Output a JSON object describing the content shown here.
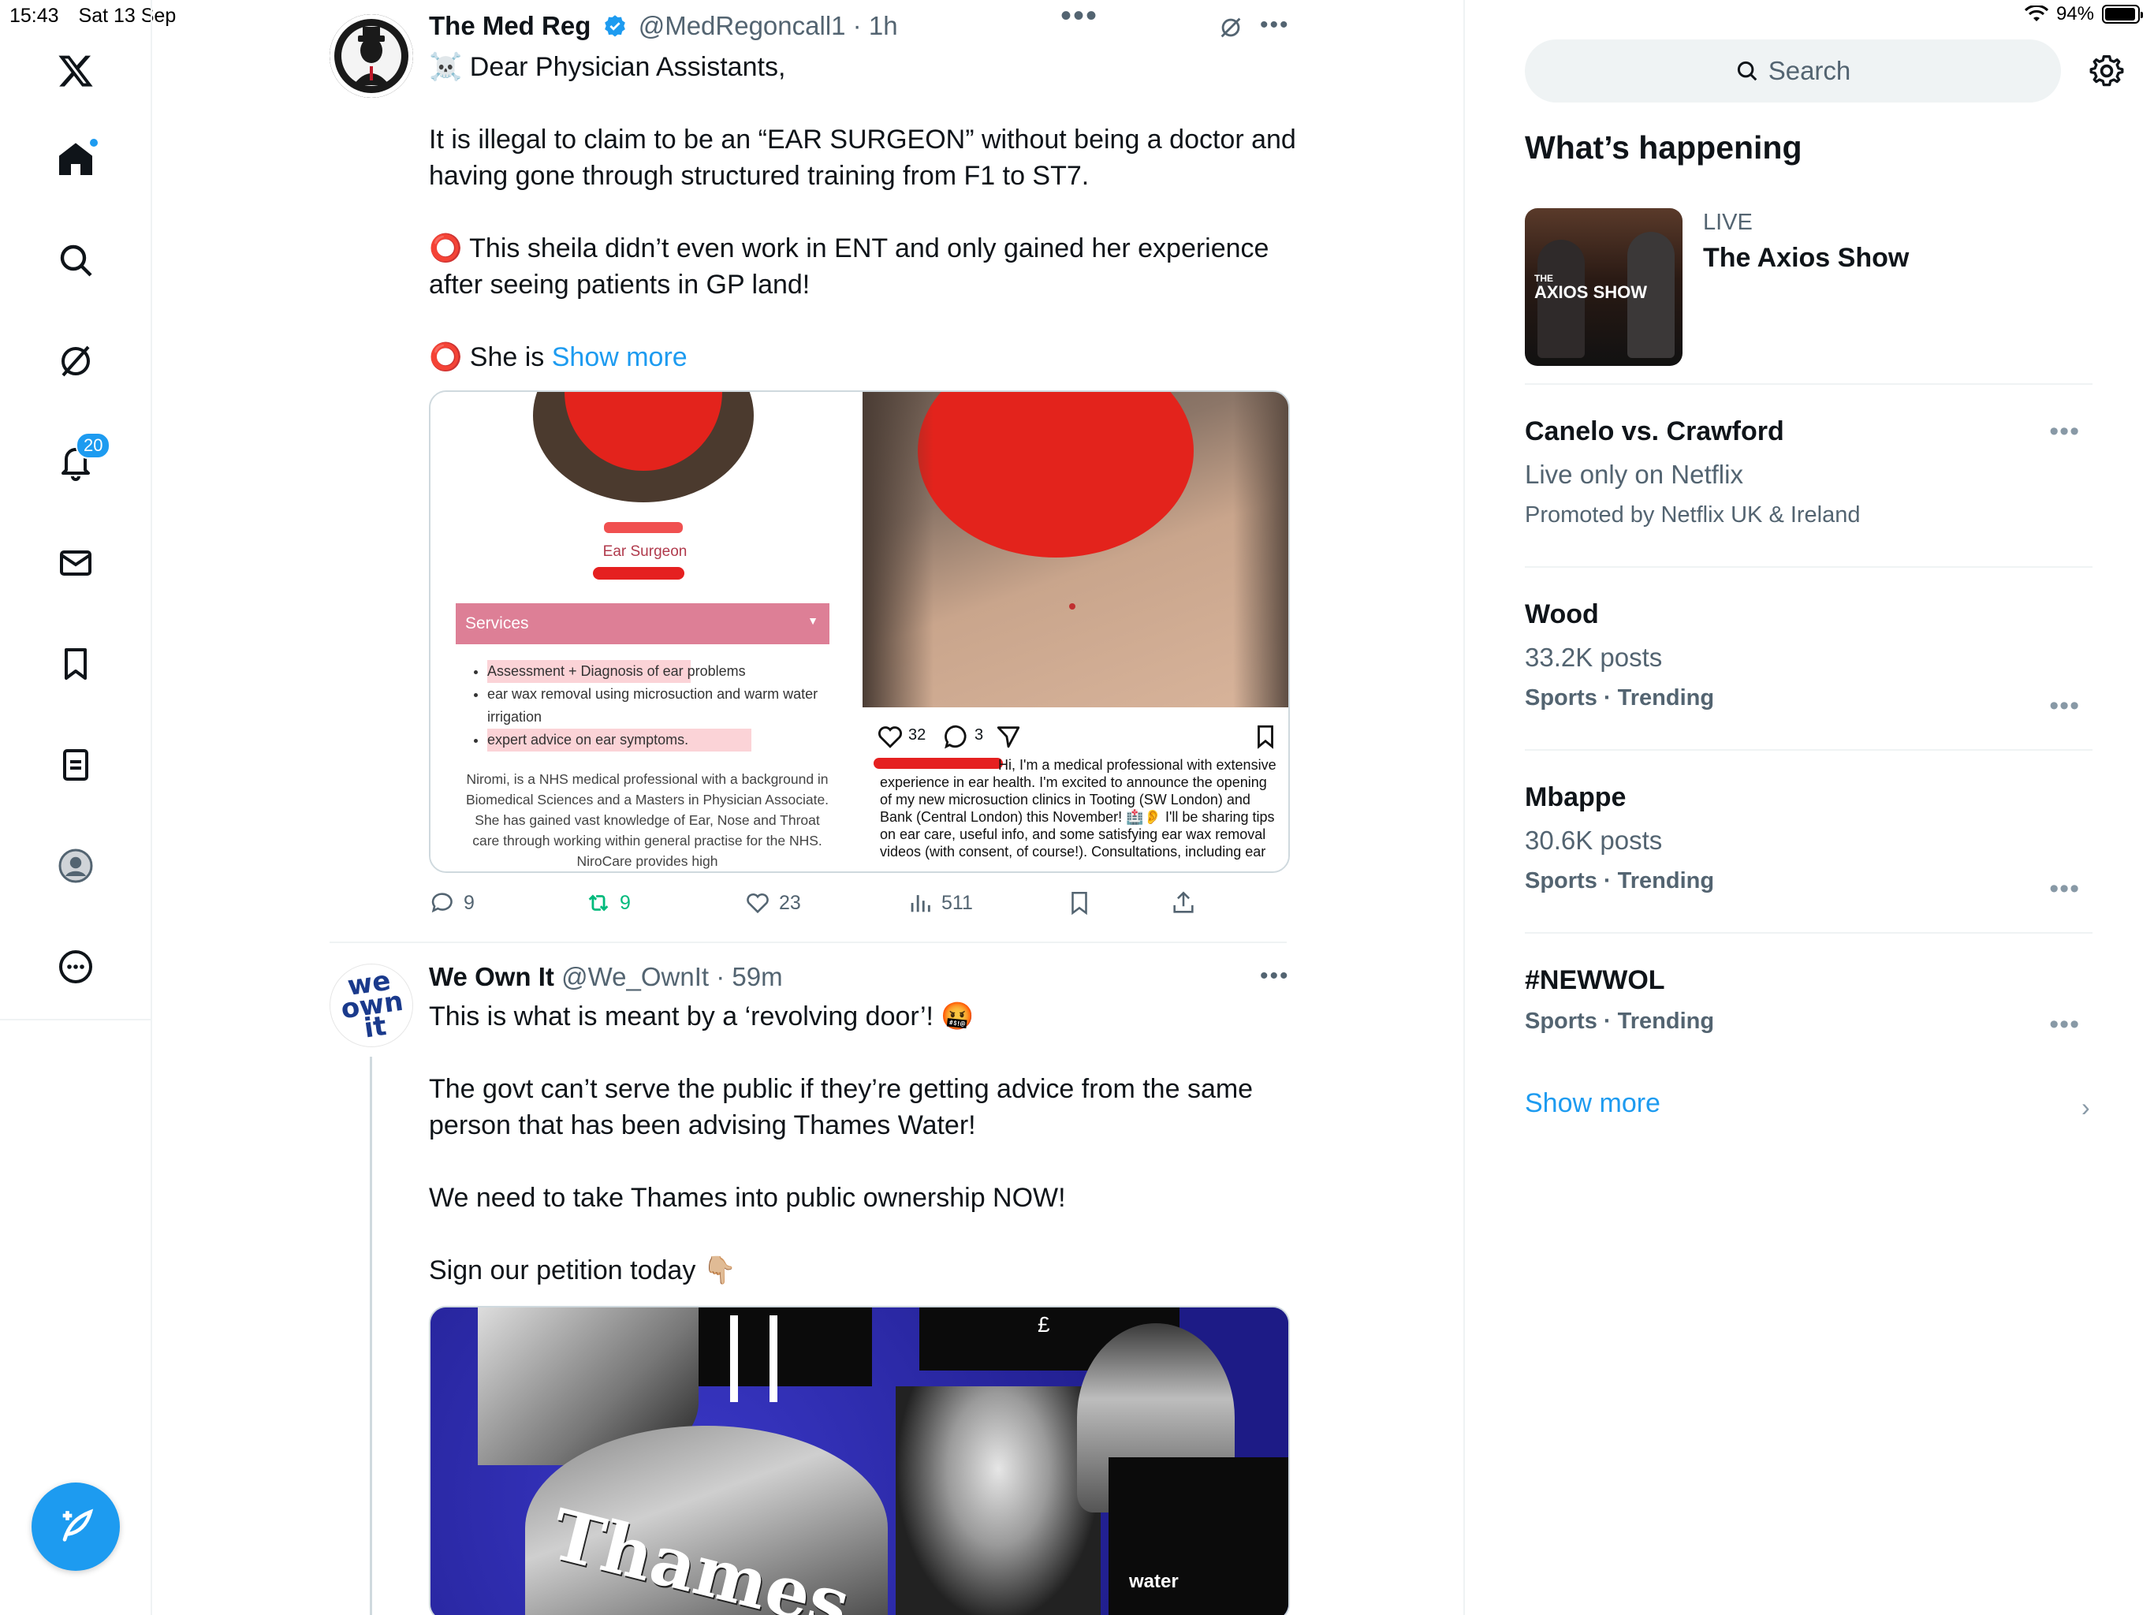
{
  "status_bar": {
    "time": "15:43",
    "date": "Sat 13 Sep",
    "battery": "94%",
    "battery_level": 0.94
  },
  "nav": {
    "notification_count": "20",
    "items": [
      "home",
      "explore",
      "grok",
      "notifications",
      "messages",
      "bookmarks",
      "lists",
      "profile",
      "more"
    ]
  },
  "tweet1": {
    "name": "The Med Reg",
    "handle": "@MedRegoncall1",
    "time": "1h",
    "line1": "☠️ Dear Physician Assistants,",
    "line2": "It is illegal to claim to be an “EAR SURGEON” without being a doctor and having gone through structured training from F1 to ST7.",
    "line3": "⭕ This sheila didn’t even work in ENT and only gained her experience after seeing patients in GP land!",
    "line4_prefix": "⭕ She is ",
    "show_more": "Show more",
    "media_left": {
      "title": "Ear Surgeon",
      "services_label": "Services",
      "service_items": [
        "Assessment + Diagnosis of ear problems",
        "ear wax removal using microsuction and warm water irrigation",
        "expert advice on ear symptoms."
      ],
      "bio": "Niromi, is a NHS medical professional with a background in Biomedical Sciences and a Masters in Physician Associate. She has gained vast knowledge of Ear, Nose and Throat care through working within general practise for the NHS. NiroCare provides high"
    },
    "media_right": {
      "likes": "32",
      "comments": "3",
      "caption": "Hi, I'm a medical professional with extensive experience in ear health. I'm excited to announce the opening of my new microsuction clinics in Tooting (SW London) and Bank (Central London) this November! 🏥👂 I'll be sharing tips on ear care, useful info, and some satisfying ear wax removal videos (with consent, of course!). Consultations, including ear"
    },
    "replies": "9",
    "reposts": "9",
    "likes": "23",
    "views": "511"
  },
  "tweet2": {
    "name": "We Own It",
    "handle": "@We_OwnIt",
    "time": "59m",
    "avatar_text": "we own it",
    "line1": "This is what is meant by a ‘revolving door’! 🤬",
    "line2": "The govt can’t serve the public if they’re  getting advice from the same person that has been advising Thames Water!",
    "line3": "We need to take Thames into public ownership NOW!",
    "line4": "Sign our petition today 👇🏼",
    "media_text_1": "Thames",
    "media_text_2": "water",
    "media_text_3": "£"
  },
  "right": {
    "search_placeholder": "Search",
    "heading": "What’s happening",
    "live": {
      "label": "LIVE",
      "title": "The Axios Show",
      "thumb_text": "AXIOS SHOW",
      "thumb_small": "THE"
    },
    "trends": [
      {
        "title": "Canelo vs. Crawford",
        "sub": "Live only on Netflix",
        "meta": "Promoted by Netflix UK & Ireland"
      },
      {
        "title": "Wood",
        "sub": "33.2K posts",
        "meta": "Sports · Trending"
      },
      {
        "title": "Mbappe",
        "sub": "30.6K posts",
        "meta": "Sports · Trending"
      },
      {
        "title": "#NEWWOL",
        "meta": "Sports · Trending"
      }
    ],
    "show_more": "Show more"
  },
  "colors": {
    "accent": "#1d9bf0",
    "repost_green": "#00ba7c",
    "text": "#0f1419",
    "secondary": "#536471"
  }
}
